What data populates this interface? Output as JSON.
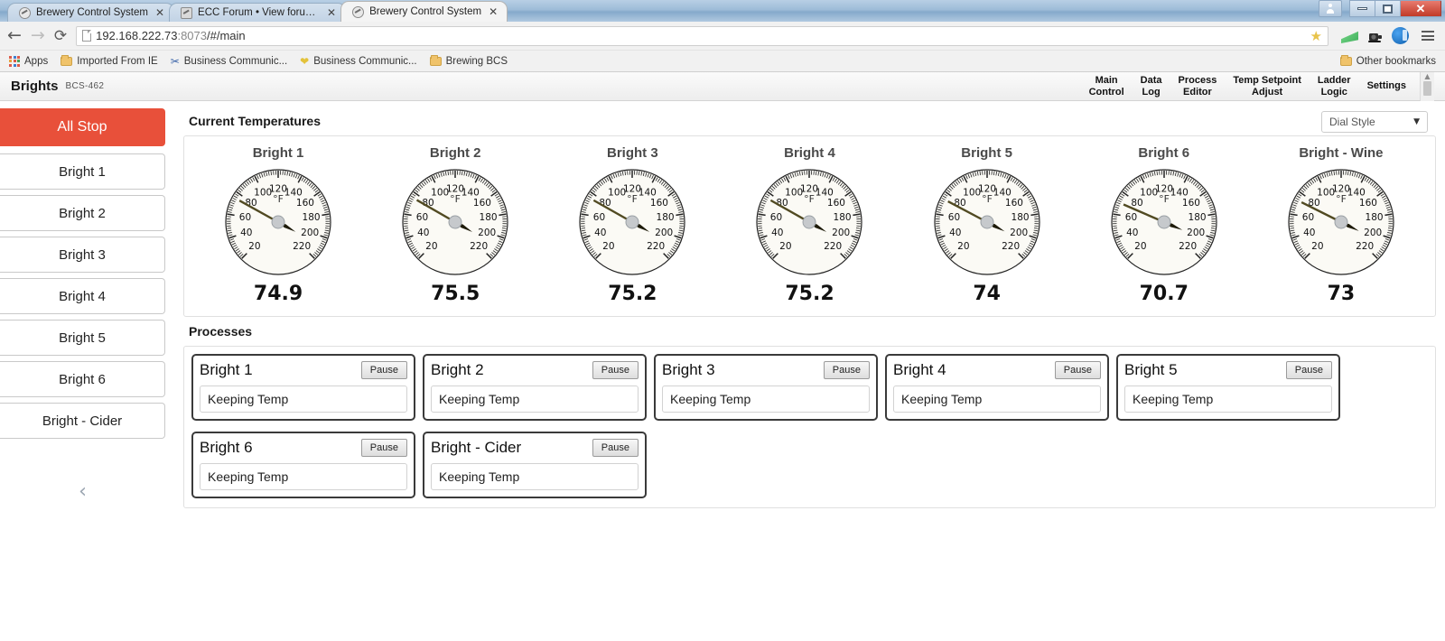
{
  "window": {
    "tabs": [
      {
        "title": "Brewery Control System",
        "favicon": "gauge-icon",
        "active": false
      },
      {
        "title": "ECC Forum • View forum -",
        "favicon": "gauge-square-icon",
        "active": false
      },
      {
        "title": "Brewery Control System",
        "favicon": "gauge-icon",
        "active": true
      }
    ],
    "close_label": "✕",
    "user_button": "user-icon",
    "minimize_label": "minimize-icon",
    "maximize_label": "restore-icon",
    "close_button_label": "✕"
  },
  "browser": {
    "back_label": "←",
    "forward_label": "→",
    "reload_label": "⟳",
    "url": "192.168.222.73",
    "url_port": ":8073",
    "url_path": "/#/main",
    "star_label": "★",
    "extensions": [
      {
        "name": "green-chart-icon"
      },
      {
        "name": "camera-icon",
        "glyph": "📷"
      },
      {
        "name": "blue-circle-icon"
      }
    ],
    "menu_label": "hamburger-menu-icon"
  },
  "bookmarks": {
    "apps_label": "Apps",
    "items": [
      {
        "label": "Imported From IE",
        "icon": "folder-icon"
      },
      {
        "label": "Business Communic...",
        "icon": "scissors-icon"
      },
      {
        "label": "Business Communic...",
        "icon": "heart-icon"
      },
      {
        "label": "Brewing BCS",
        "icon": "folder-icon"
      }
    ],
    "other_label": "Other bookmarks"
  },
  "app": {
    "brand": "Brights",
    "model": "BCS-462",
    "nav": [
      {
        "line1": "Main",
        "line2": "Control"
      },
      {
        "line1": "Data",
        "line2": "Log"
      },
      {
        "line1": "Process",
        "line2": "Editor"
      },
      {
        "line1": "Temp Setpoint",
        "line2": "Adjust"
      },
      {
        "line1": "Ladder",
        "line2": "Logic"
      },
      {
        "line1": "Settings",
        "line2": ""
      }
    ]
  },
  "sidebar": {
    "items": [
      {
        "label": "All Stop",
        "kind": "stop"
      },
      {
        "label": "Bright 1",
        "kind": "normal"
      },
      {
        "label": "Bright 2",
        "kind": "normal"
      },
      {
        "label": "Bright 3",
        "kind": "normal"
      },
      {
        "label": "Bright 4",
        "kind": "normal"
      },
      {
        "label": "Bright 5",
        "kind": "normal"
      },
      {
        "label": "Bright 6",
        "kind": "normal"
      },
      {
        "label": "Bright - Cider",
        "kind": "normal"
      }
    ],
    "collapse_label": "‹"
  },
  "main": {
    "temperatures_title": "Current Temperatures",
    "processes_title": "Processes",
    "dial_style": {
      "value": "Dial Style",
      "caret": "▼"
    }
  },
  "chart_data": {
    "type": "gauge",
    "title": "Current Temperatures",
    "unit": "°F",
    "scale_min": 20,
    "scale_max": 220,
    "tick_labels": [
      20,
      40,
      60,
      80,
      100,
      120,
      140,
      160,
      180,
      200,
      220
    ],
    "major_step": 20,
    "minor_ticks_per_major": 10,
    "gauges": [
      {
        "name": "Bright 1",
        "value": 74.9
      },
      {
        "name": "Bright 2",
        "value": 75.5
      },
      {
        "name": "Bright 3",
        "value": 75.2
      },
      {
        "name": "Bright 4",
        "value": 75.2
      },
      {
        "name": "Bright 5",
        "value": 74.0
      },
      {
        "name": "Bright 6",
        "value": 70.7
      },
      {
        "name": "Bright - Wine",
        "value": 73.0
      }
    ]
  },
  "processes": {
    "pause_label": "Pause",
    "rows": [
      [
        {
          "name": "Bright 1",
          "state": "Keeping Temp"
        },
        {
          "name": "Bright 2",
          "state": "Keeping Temp"
        },
        {
          "name": "Bright 3",
          "state": "Keeping Temp"
        },
        {
          "name": "Bright 4",
          "state": "Keeping Temp"
        },
        {
          "name": "Bright 5",
          "state": "Keeping Temp"
        }
      ],
      [
        {
          "name": "Bright 6",
          "state": "Keeping Temp"
        },
        {
          "name": "Bright - Cider",
          "state": "Keeping Temp"
        }
      ]
    ]
  },
  "colors": {
    "accent_stop": "#e8503a",
    "needle": "#514a22",
    "gauge_face": "#fbfaf5"
  }
}
